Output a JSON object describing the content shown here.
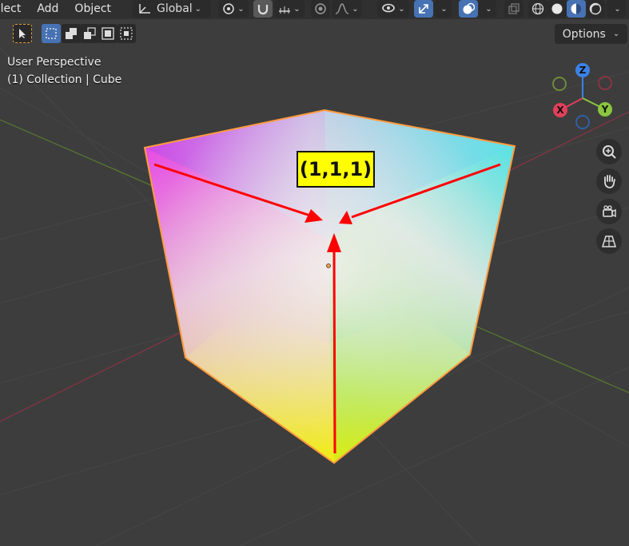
{
  "menu": {
    "select": "elect",
    "add": "Add",
    "object": "Object"
  },
  "header": {
    "orientation": "Global",
    "options": "Options"
  },
  "viewport": {
    "perspective": "User Perspective",
    "collection": "(1) Collection | Cube"
  },
  "gizmo": {
    "x": "X",
    "y": "Y",
    "z": "Z"
  },
  "annotation": {
    "label": "(1,1,1)"
  },
  "colors": {
    "axis_x": "#e0405a",
    "axis_y": "#8bc53f",
    "axis_z": "#3b82e6",
    "accent": "#4772b3",
    "arrow": "#ff0000",
    "outline": "#ff9a3c"
  }
}
